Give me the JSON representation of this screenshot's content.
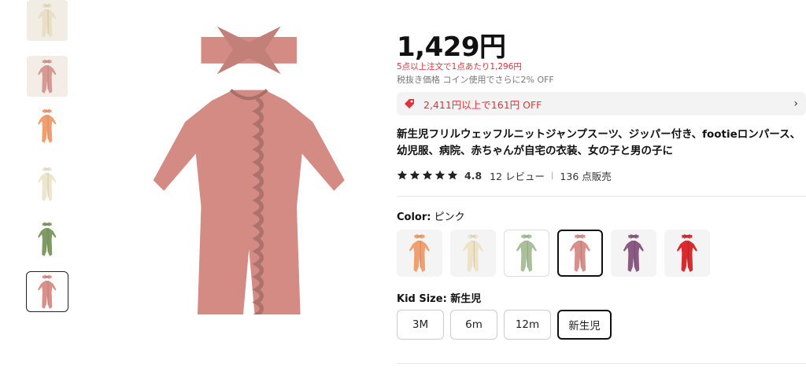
{
  "gallery": {
    "thumbnails": [
      {
        "name": "thumb-cream-top",
        "color": "#e9dfc4"
      },
      {
        "name": "thumb-lifestyle",
        "color": "#d79a93"
      },
      {
        "name": "thumb-orange",
        "color": "#f0a070"
      },
      {
        "name": "thumb-cream",
        "color": "#eee6cc"
      },
      {
        "name": "thumb-green",
        "color": "#7f9a62"
      },
      {
        "name": "thumb-pink",
        "color": "#d9908a"
      }
    ],
    "selected_index": 5,
    "main_color": "#d48b84"
  },
  "product": {
    "price": "1,429円",
    "bulk_discount": "5点以上注文で1点あたり1,296円",
    "tax_note": "税抜き価格 コイン使用でさらに2% OFF",
    "coupon": "2,411円以上で161円 OFF",
    "coupon_arrow": "›",
    "title": "新生児フリルウェッフルニットジャンプスーツ、ジッパー付き、footieロンパース、幼児服、病院、赤ちゃんが自宅の衣装、女の子と男の子に",
    "rating": "4.8",
    "reviews": "12 レビュー",
    "separator": "|",
    "sold": "136 点販売"
  },
  "color": {
    "label": "Color:",
    "selected": "ピンク",
    "options": [
      {
        "name": "orange",
        "hex": "#f0a070"
      },
      {
        "name": "cream",
        "hex": "#eee3c6"
      },
      {
        "name": "sage",
        "hex": "#a9c09a"
      },
      {
        "name": "pink",
        "hex": "#d9908a"
      },
      {
        "name": "purple",
        "hex": "#8a5a82"
      },
      {
        "name": "red",
        "hex": "#d92b2e"
      }
    ],
    "selected_index": 3
  },
  "size": {
    "label": "Kid Size: 新生児",
    "options": [
      "3M",
      "6m",
      "12m",
      "新生児"
    ],
    "selected_index": 3
  },
  "colors": {
    "accent_red": "#e0323c",
    "text": "#111111"
  }
}
